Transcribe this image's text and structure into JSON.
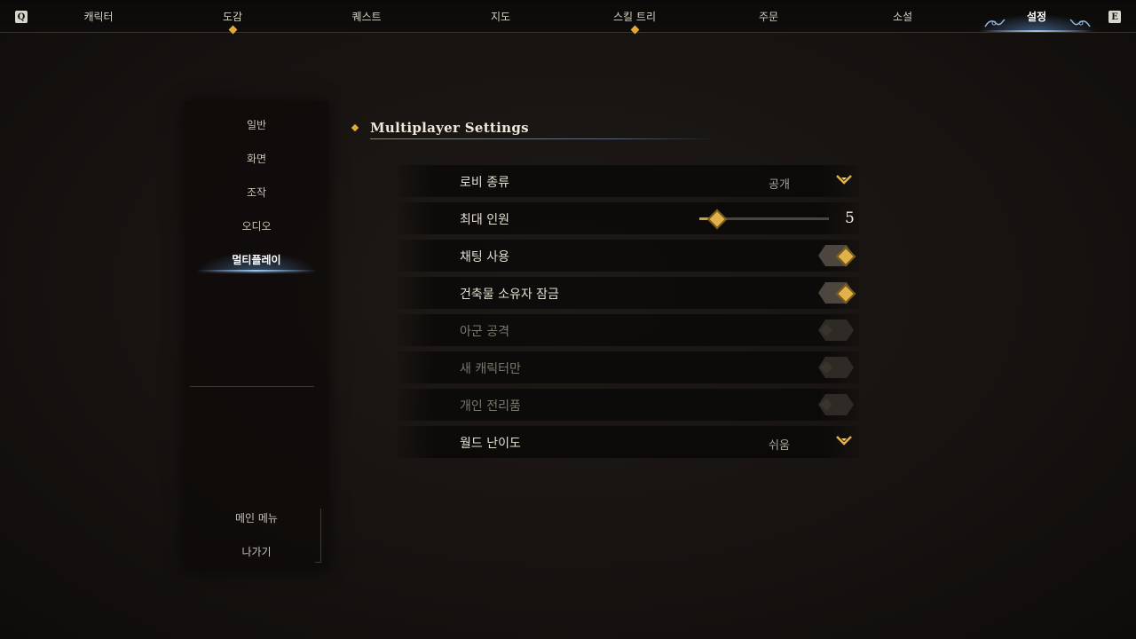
{
  "nav": {
    "prev_key": "Q",
    "next_key": "E",
    "tabs": [
      {
        "label": "캐릭터",
        "has_dot": false,
        "active": false
      },
      {
        "label": "도감",
        "has_dot": true,
        "active": false
      },
      {
        "label": "퀘스트",
        "has_dot": false,
        "active": false
      },
      {
        "label": "지도",
        "has_dot": false,
        "active": false
      },
      {
        "label": "스킬 트리",
        "has_dot": true,
        "active": false
      },
      {
        "label": "주문",
        "has_dot": false,
        "active": false
      },
      {
        "label": "소설",
        "has_dot": false,
        "active": false
      },
      {
        "label": "설정",
        "has_dot": false,
        "active": true
      }
    ]
  },
  "sidebar": {
    "items": [
      {
        "label": "일반"
      },
      {
        "label": "화면"
      },
      {
        "label": "조작"
      },
      {
        "label": "오디오"
      },
      {
        "label": "멀티플레이",
        "active": true
      }
    ],
    "bottom": [
      {
        "label": "메인 메뉴"
      },
      {
        "label": "나가기"
      }
    ]
  },
  "section": {
    "title": "Multiplayer Settings"
  },
  "settings": [
    {
      "label": "로비 종류",
      "type": "dropdown",
      "value": "공개",
      "enabled": true
    },
    {
      "label": "최대 인원",
      "type": "slider",
      "value": "5",
      "fill": 0.13,
      "enabled": true
    },
    {
      "label": "채팅 사용",
      "type": "toggle",
      "on": true,
      "enabled": true
    },
    {
      "label": "건축물 소유자 잠금",
      "type": "toggle",
      "on": true,
      "enabled": true
    },
    {
      "label": "아군 공격",
      "type": "toggle",
      "on": false,
      "enabled": false
    },
    {
      "label": "새 캐릭터만",
      "type": "toggle",
      "on": false,
      "enabled": false
    },
    {
      "label": "개인 전리품",
      "type": "toggle",
      "on": false,
      "enabled": false
    },
    {
      "label": "월드 난이도",
      "type": "dropdown",
      "value": "쉬움",
      "enabled": true
    }
  ],
  "colors": {
    "accent_gold": "#e2a83a",
    "active_blue": "#9cc4ee"
  }
}
